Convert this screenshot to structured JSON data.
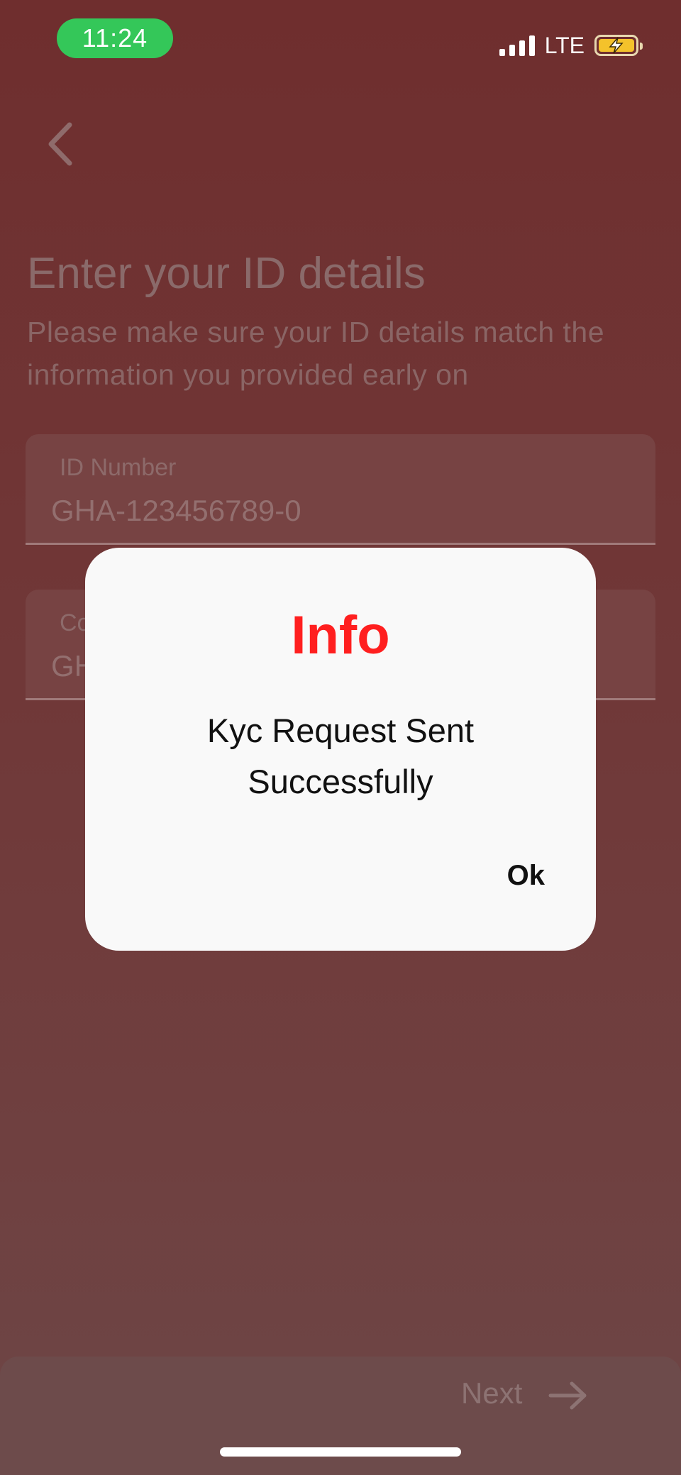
{
  "status_bar": {
    "time": "11:24",
    "network": "LTE",
    "icons": [
      "signal-icon",
      "battery-charging-icon"
    ],
    "time_pill_color": "#34c759",
    "battery_color": "#f4c22b"
  },
  "header": {
    "back_icon": "chevron-left-icon"
  },
  "page": {
    "title": "Enter your ID details",
    "subtitle": "Please make sure your ID details match the information you provided early on"
  },
  "form": {
    "id_number": {
      "label": "ID Number",
      "value": "GHA-123456789-0"
    },
    "second_field": {
      "label": "Co",
      "value": "GH"
    }
  },
  "footer": {
    "next_label": "Next",
    "next_icon": "arrow-right-icon"
  },
  "dialog": {
    "title": "Info",
    "message": "Kyc Request Sent Successfully",
    "ok_label": "Ok",
    "title_color": "#ff1f1f"
  }
}
